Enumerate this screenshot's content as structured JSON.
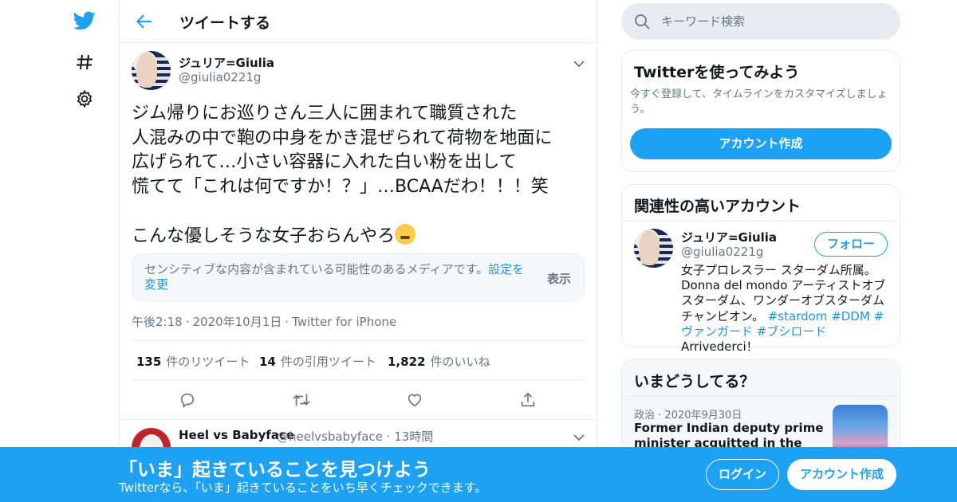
{
  "colors": {
    "accent": "#1da1f2",
    "link": "#1b95e0",
    "secondary_text": "#657786",
    "border": "#e6ecf0"
  },
  "nav": {
    "logo_icon": "twitter-bird-icon",
    "explore_icon": "hashtag-icon",
    "settings_icon": "gear-icon"
  },
  "header": {
    "back_icon": "arrow-left-icon",
    "title": "ツイートする"
  },
  "tweet": {
    "author_name": "ジュリア=Giulia",
    "author_handle": "@giulia0221g",
    "text_lines": [
      "ジム帰りにお巡りさん三人に囲まれて職質された",
      "人混みの中で鞄の中身をかき混ぜられて荷物を地面に",
      "広げられて…小さい容器に入れた白い粉を出して",
      "慌てて「これは何ですか！？」…BCAAだわ！！！笑",
      "",
      "こんな優しそうな女子おらんやろ"
    ],
    "emoji_icon": "steaming-face-icon",
    "sensitive_notice": "センシティブな内容が含まれている可能性のあるメディアです。",
    "sensitive_link": "設定を変更",
    "sensitive_show": "表示",
    "time": "午後2:18",
    "date": "2020年10月1日",
    "source": "Twitter for iPhone",
    "retweets_count": "135",
    "retweets_label": "件のリツイート",
    "quotes_count": "14",
    "quotes_label": "件の引用ツイート",
    "likes_count": "1,822",
    "likes_label": "件のいいね"
  },
  "reply": {
    "author_name": "Heel vs Babyface",
    "author_handle": "@heelvsbabyface",
    "time_ago": "13時間"
  },
  "search": {
    "placeholder": "キーワード検索"
  },
  "signup_card": {
    "title": "Twitterを使ってみよう",
    "description": "今すぐ登録して、タイムラインをカスタマイズしましょう。",
    "button": "アカウント作成"
  },
  "related_card": {
    "title": "関連性の高いアカウント",
    "name": "ジュリア=Giulia",
    "handle": "@giulia0221g",
    "follow_button": "フォロー",
    "bio_text": "女子プロレスラー スターダム所属。 Donna del mondo アーティストオブスターダム、ワンダーオブスターダムチャンピオン。",
    "bio_tags": [
      "#stardom",
      "#DDM",
      "#ヴァンガード",
      "#ブシロード"
    ],
    "bio_end": "Arrivederci！"
  },
  "trends_card": {
    "title": "いまどうしてる？",
    "category": "政治",
    "date": "2020年9月30日",
    "headline": "Former Indian deputy prime minister acquitted in the demolition"
  },
  "banner": {
    "title": "「いま」起きていることを見つけよう",
    "subtitle": "Twitterなら、「いま」起きていることをいち早くチェックできます。",
    "login": "ログイン",
    "signup": "アカウント作成"
  }
}
